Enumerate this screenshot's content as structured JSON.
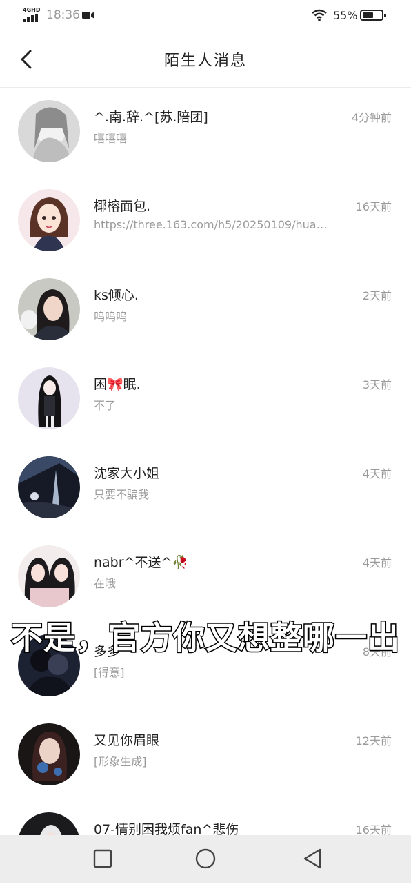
{
  "status_bar": {
    "network": "4GHD",
    "time": "18:36",
    "battery": "55%"
  },
  "header": {
    "title": "陌生人消息"
  },
  "conversations": [
    {
      "name": "^.南.辞.^[苏.陪团]",
      "message": "嘻嘻嘻",
      "time": "4分钟前",
      "avatar": "gray-anime-avatar"
    },
    {
      "name": "椰榕面包.",
      "message": "https://three.163.com/h5/20250109/hua…",
      "time": "16天前",
      "avatar": "cartoon-girl-avatar"
    },
    {
      "name": "ks倾心.",
      "message": "呜呜呜",
      "time": "2天前",
      "avatar": "photo-girl-avatar"
    },
    {
      "name": "困🎀眠.",
      "message": "不了",
      "time": "3天前",
      "avatar": "anime-girl-avatar"
    },
    {
      "name": "沈家大小姐",
      "message": "只要不骗我",
      "time": "4天前",
      "avatar": "night-scene-avatar"
    },
    {
      "name": "nabr^不送^🥀",
      "message": "在哦",
      "time": "4天前",
      "avatar": "two-girls-avatar"
    },
    {
      "name": "多多",
      "message": "[得意]",
      "time": "8天前",
      "avatar": "couple-avatar"
    },
    {
      "name": "又见你眉眼",
      "message": "[形象生成]",
      "time": "12天前",
      "avatar": "blue-rose-avatar"
    },
    {
      "name": "07-情别困我烦fan^悲伤",
      "message": "",
      "time": "16天前",
      "avatar": "white-hair-avatar"
    }
  ],
  "overlay_caption": "不是，官方你又想整哪一出",
  "colors": {
    "text_primary": "#222222",
    "text_secondary": "#9a9a9a",
    "nav_bar": "#ededed"
  }
}
